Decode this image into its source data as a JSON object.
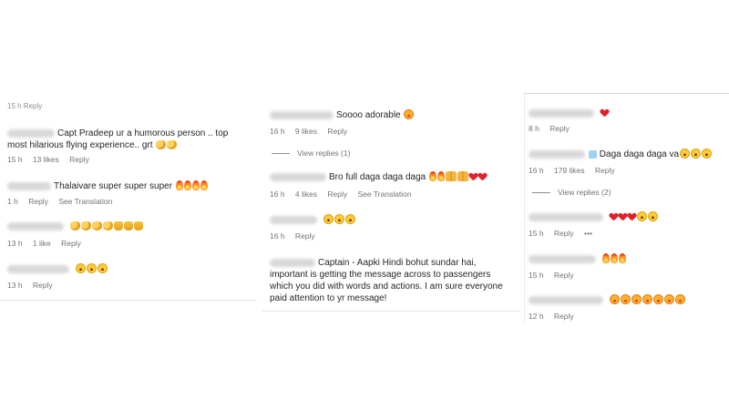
{
  "col1": {
    "truncated": "15 h   Reply",
    "comments": [
      {
        "text": "Capt Pradeep ur a humorous person .. top most hilarious flying experience.. grt",
        "time": "15 h",
        "likes": "13 likes",
        "reply": "Reply",
        "icons": [
          "clap-emoji",
          "clap-emoji"
        ]
      },
      {
        "text": "Thalaivare super super super",
        "time": "1 h",
        "reply": "Reply",
        "translate": "See Translation",
        "icons": [
          "fire-emoji",
          "fire-emoji",
          "fire-emoji",
          "fire-emoji"
        ]
      },
      {
        "text": "",
        "time": "13 h",
        "likes": "1 like",
        "reply": "Reply",
        "icons": [
          "clap-emoji",
          "clap-emoji",
          "clap-emoji",
          "clap-emoji",
          "thumbs-up-emoji",
          "thumbs-up-emoji",
          "thumbs-up-emoji"
        ]
      },
      {
        "text": "",
        "time": "13 h",
        "reply": "Reply",
        "icons": [
          "laughing-emoji",
          "laughing-emoji",
          "laughing-emoji"
        ]
      }
    ]
  },
  "col2": {
    "comments": [
      {
        "text": "Soooo adorable",
        "time": "16 h",
        "likes": "9 likes",
        "reply": "Reply",
        "view_replies": "View replies (1)",
        "icons": [
          "heart-eyes-emoji"
        ]
      },
      {
        "text": "Bro full daga daga daga",
        "time": "16 h",
        "likes": "4 likes",
        "reply": "Reply",
        "translate": "See Translation",
        "icons": [
          "fire-emoji",
          "fire-emoji",
          "praying-emoji",
          "praying-emoji",
          "heart-emoji",
          "heart-emoji"
        ]
      },
      {
        "text": "",
        "time": "16 h",
        "reply": "Reply",
        "icons": [
          "laughing-emoji",
          "laughing-emoji",
          "laughing-emoji"
        ]
      },
      {
        "text": "Captain - Aapki Hindi bohut sundar hai, important is getting the message across to passengers which you did with words and actions. I am sure everyone paid attention to yr message!"
      }
    ]
  },
  "col3": {
    "comments": [
      {
        "text": "",
        "time": "8 h",
        "reply": "Reply",
        "icons": [
          "heart-emoji"
        ]
      },
      {
        "text": "Daga daga daga va",
        "time": "16 h",
        "likes": "179 likes",
        "reply": "Reply",
        "view_replies": "View replies (2)",
        "icons": [
          "laughing-emoji",
          "laughing-emoji",
          "laughing-emoji"
        ]
      },
      {
        "text": "",
        "time": "15 h",
        "reply": "Reply",
        "more": "•••",
        "icons": [
          "heart-emoji",
          "heart-emoji",
          "heart-emoji",
          "laughing-emoji",
          "laughing-emoji"
        ]
      },
      {
        "text": "",
        "time": "15 h",
        "reply": "Reply",
        "icons": [
          "fire-emoji",
          "fire-emoji",
          "fire-emoji"
        ]
      },
      {
        "text": "",
        "time": "12 h",
        "reply": "Reply",
        "icons": [
          "heart-eyes-emoji",
          "heart-eyes-emoji",
          "heart-eyes-emoji",
          "heart-eyes-emoji",
          "heart-eyes-emoji",
          "heart-eyes-emoji",
          "heart-eyes-emoji"
        ]
      }
    ]
  }
}
